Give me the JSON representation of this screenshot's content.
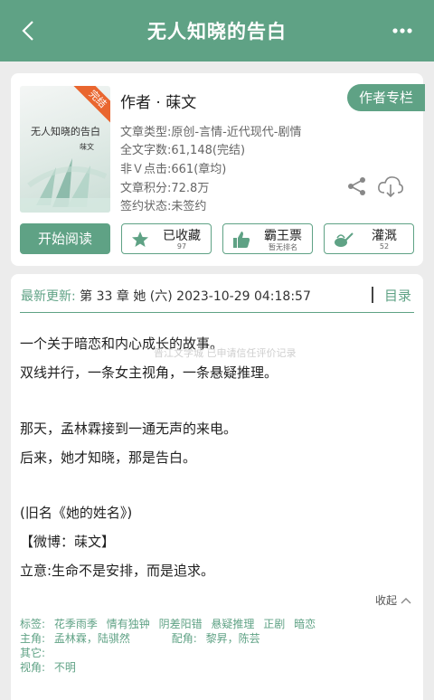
{
  "header": {
    "title": "无人知晓的告白",
    "back_icon": "chevron-left-icon",
    "more_icon": "more-dots-icon"
  },
  "book": {
    "cover": {
      "title": "无人知晓的告白",
      "author": "菋文",
      "ribbon": "完结"
    },
    "author_line": "作者 · 菋文",
    "author_column_button": "作者专栏",
    "info": [
      "文章类型:原创-言情-近代现代-剧情",
      "全文字数:61,148(完结)",
      "非Ｖ点击:661(章均)",
      "文章积分:72.8万",
      "签约状态:未签约"
    ],
    "share_icon": "share-icon",
    "download_icon": "cloud-download-icon"
  },
  "actions": {
    "read": "开始阅读",
    "collect": {
      "label": "已收藏",
      "sub": "97",
      "icon": "star-icon"
    },
    "bawang": {
      "label": "霸王票",
      "sub": "暂无排名",
      "icon": "thumbs-up-icon"
    },
    "guangai": {
      "label": "灌溉",
      "sub": "52",
      "icon": "watering-can-icon"
    }
  },
  "update": {
    "label": "最新更新:",
    "value": "第 33 章 她 (六) 2023-10-29 04:18:57",
    "catalog": "目录"
  },
  "intro": {
    "lines": [
      "一个关于暗恋和内心成长的故事。",
      "双线并行，一条女主视角，一条悬疑推理。",
      "那天，孟林霖接到一通无声的来电。",
      "后来，她才知晓，那是告白。",
      "(旧名《她的姓名》)",
      "【微博：菋文】",
      "立意:生命不是安排，而是追求。"
    ],
    "watermark": "晋江文学城 已申请信任评价记录",
    "collapse": "收起"
  },
  "tags": {
    "tags_label": "标签:",
    "tags": [
      "花季雨季",
      "情有独钟",
      "阴差阳错",
      "悬疑推理",
      "正剧",
      "暗恋"
    ],
    "lead_label": "主角:",
    "lead": "孟林霖，陆骐然",
    "support_label": "配角:",
    "support": "黎昇，陈芸",
    "other_label": "其它:",
    "other": "",
    "pov_label": "视角:",
    "pov": "不明"
  },
  "colors": {
    "accent": "#5fa285",
    "ribbon": "#e9662f",
    "background": "#ececec"
  }
}
